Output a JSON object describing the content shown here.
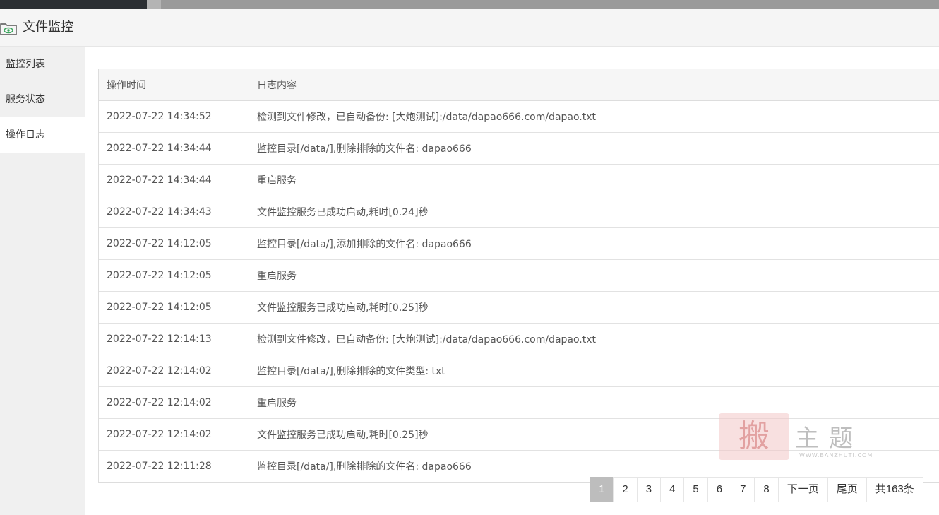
{
  "app": {
    "title": "文件监控"
  },
  "sidebar": {
    "items": [
      {
        "label": "监控列表"
      },
      {
        "label": "服务状态"
      },
      {
        "label": "操作日志"
      }
    ],
    "active_index": 2
  },
  "table": {
    "headers": [
      "操作时间",
      "日志内容"
    ],
    "rows": [
      {
        "time": "2022-07-22 14:34:52",
        "content": "检测到文件修改，已自动备份: [大炮测试]:/data/dapao666.com/dapao.txt"
      },
      {
        "time": "2022-07-22 14:34:44",
        "content": "监控目录[/data/],删除排除的文件名: dapao666"
      },
      {
        "time": "2022-07-22 14:34:44",
        "content": "重启服务"
      },
      {
        "time": "2022-07-22 14:34:43",
        "content": "文件监控服务已成功启动,耗时[0.24]秒"
      },
      {
        "time": "2022-07-22 14:12:05",
        "content": "监控目录[/data/],添加排除的文件名: dapao666"
      },
      {
        "time": "2022-07-22 14:12:05",
        "content": "重启服务"
      },
      {
        "time": "2022-07-22 14:12:05",
        "content": "文件监控服务已成功启动,耗时[0.25]秒"
      },
      {
        "time": "2022-07-22 12:14:13",
        "content": "检测到文件修改，已自动备份: [大炮测试]:/data/dapao666.com/dapao.txt"
      },
      {
        "time": "2022-07-22 12:14:02",
        "content": "监控目录[/data/],删除排除的文件类型: txt"
      },
      {
        "time": "2022-07-22 12:14:02",
        "content": "重启服务"
      },
      {
        "time": "2022-07-22 12:14:02",
        "content": "文件监控服务已成功启动,耗时[0.25]秒"
      },
      {
        "time": "2022-07-22 12:11:28",
        "content": "监控目录[/data/],删除排除的文件名: dapao666"
      }
    ]
  },
  "pagination": {
    "pages": [
      "1",
      "2",
      "3",
      "4",
      "5",
      "6",
      "7",
      "8"
    ],
    "current": "1",
    "next_label": "下一页",
    "last_label": "尾页",
    "total_label": "共163条"
  },
  "watermark": {
    "seal_char": "搬",
    "text": "主题",
    "url": "WWW.BANZHUTI.COM"
  },
  "colors": {
    "sidebar_bg": "#f0f0f0",
    "titlebar_bg": "#f5f5f5",
    "pager_active": "#bdbdbd",
    "icon_green": "#3aa55d"
  },
  "icons": {
    "app_icon": "folder-eye-icon"
  }
}
